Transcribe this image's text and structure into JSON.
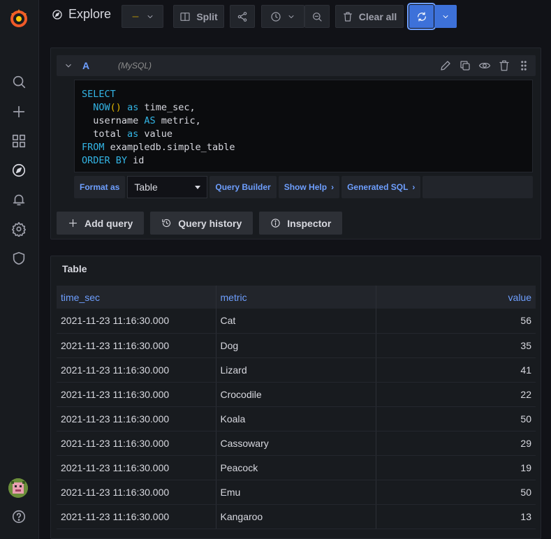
{
  "header": {
    "title": "Explore",
    "split_label": "Split",
    "clear_all_label": "Clear all"
  },
  "query": {
    "ref_id": "A",
    "datasource": "(MySQL)",
    "sql_lines": [
      [
        {
          "t": "SELECT",
          "c": "kw"
        }
      ],
      [
        {
          "t": "  "
        },
        {
          "t": "NOW",
          "c": "fn"
        },
        {
          "t": "()",
          "c": "paren"
        },
        {
          "t": " "
        },
        {
          "t": "as",
          "c": "kw"
        },
        {
          "t": " time_sec,"
        }
      ],
      [
        {
          "t": "  username "
        },
        {
          "t": "AS",
          "c": "kw"
        },
        {
          "t": " metric,"
        }
      ],
      [
        {
          "t": "  total "
        },
        {
          "t": "as",
          "c": "kw"
        },
        {
          "t": " value"
        }
      ],
      [
        {
          "t": "FROM",
          "c": "kw"
        },
        {
          "t": " exampledb.simple_table"
        }
      ],
      [
        {
          "t": "ORDER BY",
          "c": "kw"
        },
        {
          "t": " id"
        }
      ]
    ],
    "format_as_label": "Format as",
    "format_value": "Table",
    "query_builder_label": "Query Builder",
    "show_help_label": "Show Help",
    "generated_sql_label": "Generated SQL",
    "add_query_label": "Add query",
    "query_history_label": "Query history",
    "inspector_label": "Inspector"
  },
  "results": {
    "title": "Table",
    "columns": [
      "time_sec",
      "metric",
      "value"
    ],
    "rows": [
      [
        "2021-11-23 11:16:30.000",
        "Cat",
        "56"
      ],
      [
        "2021-11-23 11:16:30.000",
        "Dog",
        "35"
      ],
      [
        "2021-11-23 11:16:30.000",
        "Lizard",
        "41"
      ],
      [
        "2021-11-23 11:16:30.000",
        "Crocodile",
        "22"
      ],
      [
        "2021-11-23 11:16:30.000",
        "Koala",
        "50"
      ],
      [
        "2021-11-23 11:16:30.000",
        "Cassowary",
        "29"
      ],
      [
        "2021-11-23 11:16:30.000",
        "Peacock",
        "19"
      ],
      [
        "2021-11-23 11:16:30.000",
        "Emu",
        "50"
      ],
      [
        "2021-11-23 11:16:30.000",
        "Kangaroo",
        "13"
      ]
    ]
  },
  "colors": {
    "accent": "#3d71d9",
    "link": "#6e9fff",
    "background": "#111217",
    "panel": "#181b1f"
  }
}
